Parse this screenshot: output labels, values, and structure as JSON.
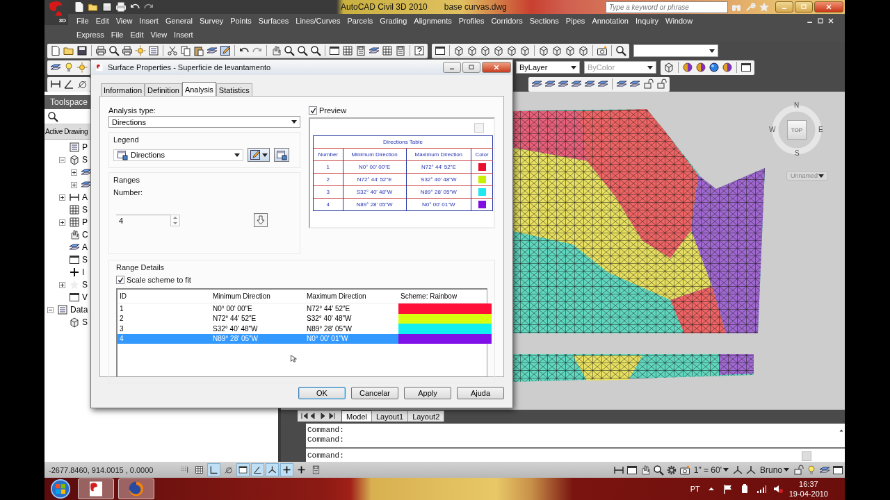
{
  "app_window": {
    "badge": "3D",
    "title": "AutoCAD Civil 3D 2010",
    "document": "base curvas.dwg",
    "search": {
      "placeholder": "Type a keyword or phrase"
    }
  },
  "menu_rows": [
    [
      "File",
      "Edit",
      "View",
      "Insert",
      "General",
      "Survey",
      "Points",
      "Surfaces",
      "Lines/Curves",
      "Parcels",
      "Grading",
      "Alignments",
      "Profiles",
      "Corridors",
      "Sections",
      "Pipes",
      "Annotation",
      "Inquiry",
      "Window"
    ],
    [
      "Express",
      "File",
      "Edit",
      "View",
      "Insert"
    ]
  ],
  "properties_toolbar": {
    "lineweight": "ByLayer",
    "plot_style": "ByColor"
  },
  "toolspace": {
    "title": "Toolspace",
    "tab": "Active Drawing",
    "branch": [
      {
        "label": "P"
      },
      {
        "label": "S",
        "expanded": true,
        "children": [
          {
            "expanded": false
          },
          {
            "expanded": false
          }
        ]
      },
      {
        "label": "A",
        "expanded": false
      },
      {
        "label": "S"
      },
      {
        "label": "P",
        "expanded": false
      },
      {
        "label": "C"
      },
      {
        "label": "A"
      },
      {
        "label": "S"
      },
      {
        "label": "I"
      },
      {
        "label": "S",
        "expanded": false
      },
      {
        "label": "V"
      }
    ],
    "items": [
      {
        "label": "Data",
        "expanded": true,
        "children": [
          {
            "label": "S"
          }
        ]
      }
    ]
  },
  "viewport": {
    "viewcube": {
      "north": "N",
      "south": "S",
      "east": "E",
      "west": "W",
      "face": "TOP"
    },
    "view_menu": "Unnamed"
  },
  "layout_tabs": [
    {
      "label": "Model",
      "selected": true
    },
    {
      "label": "Layout1",
      "selected": false
    },
    {
      "label": "Layout2",
      "selected": false
    }
  ],
  "command_lines": [
    "Command:",
    "Command:",
    "Command:"
  ],
  "status_bar": {
    "coordinates": "-2677.8460, 914.0015 , 0.0000",
    "toggles": [
      {
        "on": false
      },
      {
        "on": false
      },
      {
        "on": true
      },
      {
        "on": false
      },
      {
        "on": true
      },
      {
        "on": true
      },
      {
        "on": true
      },
      {
        "on": true
      },
      {
        "on": false
      },
      {
        "on": false
      }
    ],
    "annotation_scale": "1\" = 60'",
    "workspace": "Bruno"
  },
  "taskbar": {
    "language": "PT",
    "time": "16:37",
    "date": "19-04-2010"
  },
  "dialog": {
    "title": "Surface Properties - Superficie de levantamento",
    "tabs": [
      {
        "label": "Information",
        "selected": false
      },
      {
        "label": "Definition",
        "selected": false
      },
      {
        "label": "Analysis",
        "selected": true
      },
      {
        "label": "Statistics",
        "selected": false
      }
    ],
    "analysis_type_label": "Analysis type:",
    "analysis_type": "Directions",
    "legend": {
      "title": "Legend",
      "style": "Directions"
    },
    "ranges": {
      "title": "Ranges",
      "number_label": "Number:",
      "number": "4"
    },
    "preview": {
      "label": "Preview",
      "checked": true,
      "table": {
        "title": "Directions Table",
        "columns": [
          "Number",
          "Minimum Direction",
          "Maximum Direction",
          "Color"
        ],
        "rows": [
          {
            "number": "1",
            "min": "N0° 00' 00\"E",
            "max": "N72° 44' 52\"E",
            "color": "#e8102c"
          },
          {
            "number": "2",
            "min": "N72° 44' 52\"E",
            "max": "S32° 40' 48\"W",
            "color": "#c8f000"
          },
          {
            "number": "3",
            "min": "S32° 40' 48\"W",
            "max": "N89° 28' 05\"W",
            "color": "#20e8f0"
          },
          {
            "number": "4",
            "min": "N89° 28' 05\"W",
            "max": "N0° 00' 01\"W",
            "color": "#8010e0"
          }
        ]
      }
    },
    "range_details": {
      "title": "Range Details",
      "scale_to_fit": {
        "label": "Scale scheme to fit",
        "checked": true
      },
      "columns": [
        "ID",
        "Minimum Direction",
        "Maximum Direction",
        "Scheme: Rainbow"
      ],
      "rows": [
        {
          "id": "1",
          "min": "N0° 00' 00\"E",
          "max": "N72° 44' 52\"E",
          "color": "#ff1038",
          "selected": false
        },
        {
          "id": "2",
          "min": "N72° 44' 52\"E",
          "max": "S32° 40' 48\"W",
          "color": "#d8ff10",
          "selected": false
        },
        {
          "id": "3",
          "min": "S32° 40' 48\"W",
          "max": "N89° 28' 05\"W",
          "color": "#10f0f0",
          "selected": false
        },
        {
          "id": "4",
          "min": "N89° 28' 05\"W",
          "max": "N0° 00' 01\"W",
          "color": "#8010e8",
          "selected": true
        }
      ]
    },
    "buttons": [
      {
        "label": "OK",
        "default": true
      },
      {
        "label": "Cancelar",
        "default": false
      },
      {
        "label": "Apply",
        "default": false
      },
      {
        "label": "Ajuda",
        "default": false
      }
    ]
  }
}
